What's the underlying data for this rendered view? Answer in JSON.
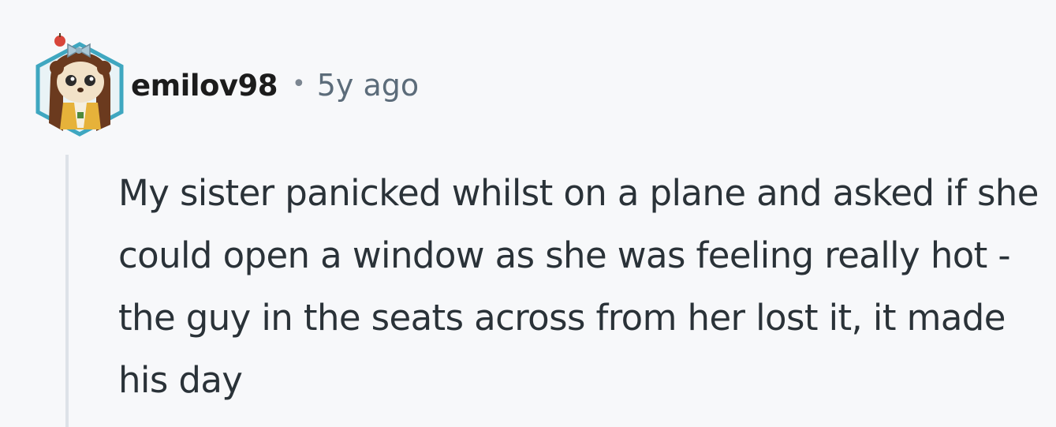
{
  "comment": {
    "username": "emilov98",
    "separator": "•",
    "timestamp": "5y ago",
    "body": "My sister panicked whilst on a plane and asked if she could open a window as she was feeling really hot - the guy in the seats across from her lost it, it made his day"
  },
  "icons": {
    "avatar": "user-avatar-icon"
  },
  "colors": {
    "background": "#f7f8fa",
    "username": "#1c1c1c",
    "timestamp": "#5c6c7a",
    "body_text": "#2a3238",
    "thread_line": "#dde2e8",
    "avatar_ring": "#3fa7c0"
  }
}
